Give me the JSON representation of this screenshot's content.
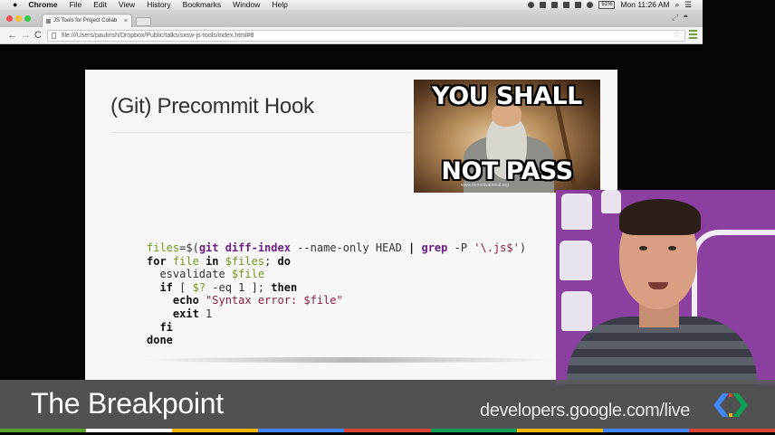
{
  "menubar": {
    "app_name": "Chrome",
    "menus": [
      "File",
      "Edit",
      "View",
      "History",
      "Bookmarks",
      "Window",
      "Help"
    ],
    "battery": "51%",
    "clock": "Mon 11:26 AM"
  },
  "browser": {
    "tab_title": "JS Tools for Project Collab",
    "tab_close": "×",
    "url": "file:///Users/paulirish/Dropbox/Public/talks/sxsw-js-tools/index.html#8",
    "nav": {
      "back": "←",
      "forward": "→",
      "reload": "C"
    },
    "star": "☆"
  },
  "slide": {
    "title": "(Git) Precommit Hook",
    "meme": {
      "top_text": "YOU SHALL",
      "bottom_text": "NOT PASS",
      "watermark": "www.demotivational.org"
    },
    "code_lines": [
      [
        {
          "t": "files",
          "c": "var"
        },
        {
          "t": "=$(",
          "c": "plain"
        },
        {
          "t": "git diff-index",
          "c": "fn"
        },
        {
          "t": " --name-only HEAD ",
          "c": "plain"
        },
        {
          "t": "|",
          "c": "kw"
        },
        {
          "t": " grep",
          "c": "fn"
        },
        {
          "t": " -P ",
          "c": "plain"
        },
        {
          "t": "'\\.js$'",
          "c": "str"
        },
        {
          "t": ")",
          "c": "plain"
        }
      ],
      [
        {
          "t": "for",
          "c": "kw"
        },
        {
          "t": " file",
          "c": "var"
        },
        {
          "t": " in",
          "c": "kw"
        },
        {
          "t": " $files",
          "c": "var"
        },
        {
          "t": "; ",
          "c": "plain"
        },
        {
          "t": "do",
          "c": "kw"
        }
      ],
      [
        {
          "t": "  esvalidate ",
          "c": "plain"
        },
        {
          "t": "$file",
          "c": "var"
        }
      ],
      [
        {
          "t": "  if",
          "c": "kw"
        },
        {
          "t": " [ ",
          "c": "plain"
        },
        {
          "t": "$?",
          "c": "var"
        },
        {
          "t": " -eq 1 ]; ",
          "c": "plain"
        },
        {
          "t": "then",
          "c": "kw"
        }
      ],
      [
        {
          "t": "    echo",
          "c": "kw"
        },
        {
          "t": " ",
          "c": "plain"
        },
        {
          "t": "\"Syntax error: $file\"",
          "c": "str"
        }
      ],
      [
        {
          "t": "    exit",
          "c": "kw"
        },
        {
          "t": " 1",
          "c": "plain"
        }
      ],
      [
        {
          "t": "  fi",
          "c": "kw"
        }
      ],
      [
        {
          "t": "done",
          "c": "kw"
        }
      ]
    ]
  },
  "banner": {
    "show_name": "The Breakpoint",
    "site": "developers.google.com/live"
  },
  "colors": {
    "brand_bar": [
      "#5aa02c",
      "#ffffff",
      "#f6b400",
      "#4285f4",
      "#db4437",
      "#0f9d58",
      "#f6b400",
      "#4285f4",
      "#db4437"
    ],
    "presenter_bg": "#8b3fa0",
    "code_var": "#6e9a1b",
    "code_fn": "#6d1f86",
    "code_str": "#8a1e42"
  },
  "icons": {
    "apple": "apple-logo-icon",
    "menu": "chrome-menu-icon",
    "logo": "google-developers-logo-icon"
  }
}
